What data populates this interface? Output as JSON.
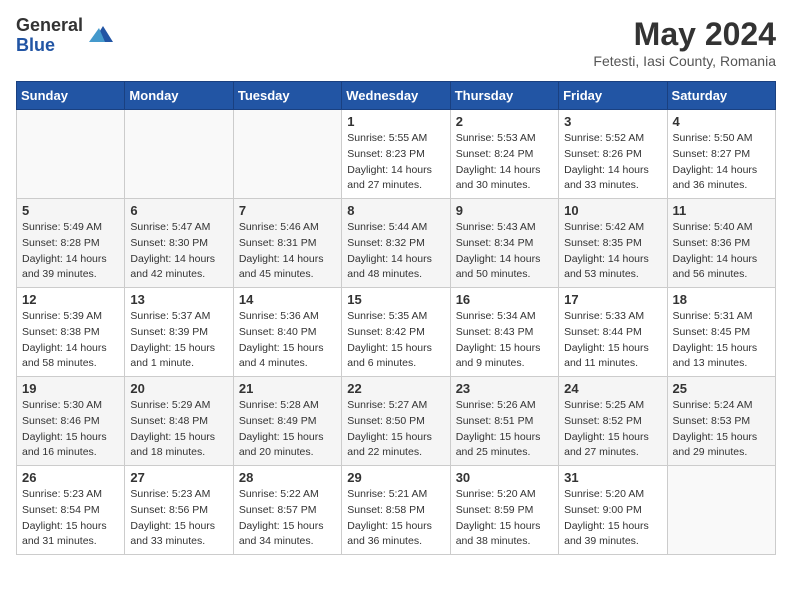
{
  "logo": {
    "general": "General",
    "blue": "Blue"
  },
  "title": {
    "month": "May 2024",
    "location": "Fetesti, Iasi County, Romania"
  },
  "weekdays": [
    "Sunday",
    "Monday",
    "Tuesday",
    "Wednesday",
    "Thursday",
    "Friday",
    "Saturday"
  ],
  "weeks": [
    [
      {
        "day": "",
        "sunrise": "",
        "sunset": "",
        "daylight": ""
      },
      {
        "day": "",
        "sunrise": "",
        "sunset": "",
        "daylight": ""
      },
      {
        "day": "",
        "sunrise": "",
        "sunset": "",
        "daylight": ""
      },
      {
        "day": "1",
        "sunrise": "Sunrise: 5:55 AM",
        "sunset": "Sunset: 8:23 PM",
        "daylight": "Daylight: 14 hours and 27 minutes."
      },
      {
        "day": "2",
        "sunrise": "Sunrise: 5:53 AM",
        "sunset": "Sunset: 8:24 PM",
        "daylight": "Daylight: 14 hours and 30 minutes."
      },
      {
        "day": "3",
        "sunrise": "Sunrise: 5:52 AM",
        "sunset": "Sunset: 8:26 PM",
        "daylight": "Daylight: 14 hours and 33 minutes."
      },
      {
        "day": "4",
        "sunrise": "Sunrise: 5:50 AM",
        "sunset": "Sunset: 8:27 PM",
        "daylight": "Daylight: 14 hours and 36 minutes."
      }
    ],
    [
      {
        "day": "5",
        "sunrise": "Sunrise: 5:49 AM",
        "sunset": "Sunset: 8:28 PM",
        "daylight": "Daylight: 14 hours and 39 minutes."
      },
      {
        "day": "6",
        "sunrise": "Sunrise: 5:47 AM",
        "sunset": "Sunset: 8:30 PM",
        "daylight": "Daylight: 14 hours and 42 minutes."
      },
      {
        "day": "7",
        "sunrise": "Sunrise: 5:46 AM",
        "sunset": "Sunset: 8:31 PM",
        "daylight": "Daylight: 14 hours and 45 minutes."
      },
      {
        "day": "8",
        "sunrise": "Sunrise: 5:44 AM",
        "sunset": "Sunset: 8:32 PM",
        "daylight": "Daylight: 14 hours and 48 minutes."
      },
      {
        "day": "9",
        "sunrise": "Sunrise: 5:43 AM",
        "sunset": "Sunset: 8:34 PM",
        "daylight": "Daylight: 14 hours and 50 minutes."
      },
      {
        "day": "10",
        "sunrise": "Sunrise: 5:42 AM",
        "sunset": "Sunset: 8:35 PM",
        "daylight": "Daylight: 14 hours and 53 minutes."
      },
      {
        "day": "11",
        "sunrise": "Sunrise: 5:40 AM",
        "sunset": "Sunset: 8:36 PM",
        "daylight": "Daylight: 14 hours and 56 minutes."
      }
    ],
    [
      {
        "day": "12",
        "sunrise": "Sunrise: 5:39 AM",
        "sunset": "Sunset: 8:38 PM",
        "daylight": "Daylight: 14 hours and 58 minutes."
      },
      {
        "day": "13",
        "sunrise": "Sunrise: 5:37 AM",
        "sunset": "Sunset: 8:39 PM",
        "daylight": "Daylight: 15 hours and 1 minute."
      },
      {
        "day": "14",
        "sunrise": "Sunrise: 5:36 AM",
        "sunset": "Sunset: 8:40 PM",
        "daylight": "Daylight: 15 hours and 4 minutes."
      },
      {
        "day": "15",
        "sunrise": "Sunrise: 5:35 AM",
        "sunset": "Sunset: 8:42 PM",
        "daylight": "Daylight: 15 hours and 6 minutes."
      },
      {
        "day": "16",
        "sunrise": "Sunrise: 5:34 AM",
        "sunset": "Sunset: 8:43 PM",
        "daylight": "Daylight: 15 hours and 9 minutes."
      },
      {
        "day": "17",
        "sunrise": "Sunrise: 5:33 AM",
        "sunset": "Sunset: 8:44 PM",
        "daylight": "Daylight: 15 hours and 11 minutes."
      },
      {
        "day": "18",
        "sunrise": "Sunrise: 5:31 AM",
        "sunset": "Sunset: 8:45 PM",
        "daylight": "Daylight: 15 hours and 13 minutes."
      }
    ],
    [
      {
        "day": "19",
        "sunrise": "Sunrise: 5:30 AM",
        "sunset": "Sunset: 8:46 PM",
        "daylight": "Daylight: 15 hours and 16 minutes."
      },
      {
        "day": "20",
        "sunrise": "Sunrise: 5:29 AM",
        "sunset": "Sunset: 8:48 PM",
        "daylight": "Daylight: 15 hours and 18 minutes."
      },
      {
        "day": "21",
        "sunrise": "Sunrise: 5:28 AM",
        "sunset": "Sunset: 8:49 PM",
        "daylight": "Daylight: 15 hours and 20 minutes."
      },
      {
        "day": "22",
        "sunrise": "Sunrise: 5:27 AM",
        "sunset": "Sunset: 8:50 PM",
        "daylight": "Daylight: 15 hours and 22 minutes."
      },
      {
        "day": "23",
        "sunrise": "Sunrise: 5:26 AM",
        "sunset": "Sunset: 8:51 PM",
        "daylight": "Daylight: 15 hours and 25 minutes."
      },
      {
        "day": "24",
        "sunrise": "Sunrise: 5:25 AM",
        "sunset": "Sunset: 8:52 PM",
        "daylight": "Daylight: 15 hours and 27 minutes."
      },
      {
        "day": "25",
        "sunrise": "Sunrise: 5:24 AM",
        "sunset": "Sunset: 8:53 PM",
        "daylight": "Daylight: 15 hours and 29 minutes."
      }
    ],
    [
      {
        "day": "26",
        "sunrise": "Sunrise: 5:23 AM",
        "sunset": "Sunset: 8:54 PM",
        "daylight": "Daylight: 15 hours and 31 minutes."
      },
      {
        "day": "27",
        "sunrise": "Sunrise: 5:23 AM",
        "sunset": "Sunset: 8:56 PM",
        "daylight": "Daylight: 15 hours and 33 minutes."
      },
      {
        "day": "28",
        "sunrise": "Sunrise: 5:22 AM",
        "sunset": "Sunset: 8:57 PM",
        "daylight": "Daylight: 15 hours and 34 minutes."
      },
      {
        "day": "29",
        "sunrise": "Sunrise: 5:21 AM",
        "sunset": "Sunset: 8:58 PM",
        "daylight": "Daylight: 15 hours and 36 minutes."
      },
      {
        "day": "30",
        "sunrise": "Sunrise: 5:20 AM",
        "sunset": "Sunset: 8:59 PM",
        "daylight": "Daylight: 15 hours and 38 minutes."
      },
      {
        "day": "31",
        "sunrise": "Sunrise: 5:20 AM",
        "sunset": "Sunset: 9:00 PM",
        "daylight": "Daylight: 15 hours and 39 minutes."
      },
      {
        "day": "",
        "sunrise": "",
        "sunset": "",
        "daylight": ""
      }
    ]
  ]
}
